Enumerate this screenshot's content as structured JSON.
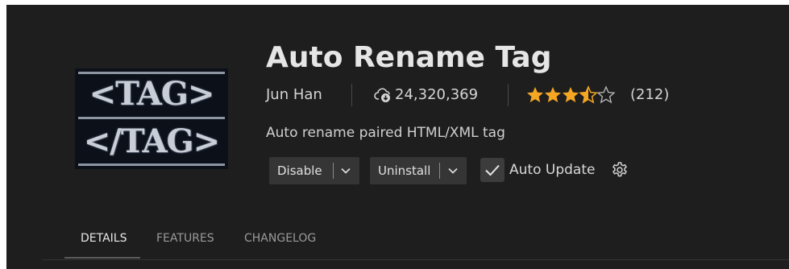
{
  "extension": {
    "title": "Auto Rename Tag",
    "author": "Jun Han",
    "installs": "24,320,369",
    "rating": 3.5,
    "rating_count": "(212)",
    "description": "Auto rename paired HTML/XML tag",
    "logo": {
      "line1": "<TAG>",
      "line2": "</TAG>"
    }
  },
  "actions": {
    "disable_label": "Disable",
    "uninstall_label": "Uninstall",
    "auto_update_label": "Auto Update",
    "auto_update_checked": true
  },
  "tabs": [
    {
      "label": "DETAILS",
      "active": true
    },
    {
      "label": "FEATURES",
      "active": false
    },
    {
      "label": "CHANGELOG",
      "active": false
    }
  ],
  "icons": {
    "installs": "cloud-download-icon",
    "star": "star-icon",
    "chevron": "chevron-down-icon",
    "check": "check-icon",
    "settings": "gear-icon"
  },
  "colors": {
    "background": "#1e1e1e",
    "star": "#f5a623",
    "text": "#cccccc"
  }
}
